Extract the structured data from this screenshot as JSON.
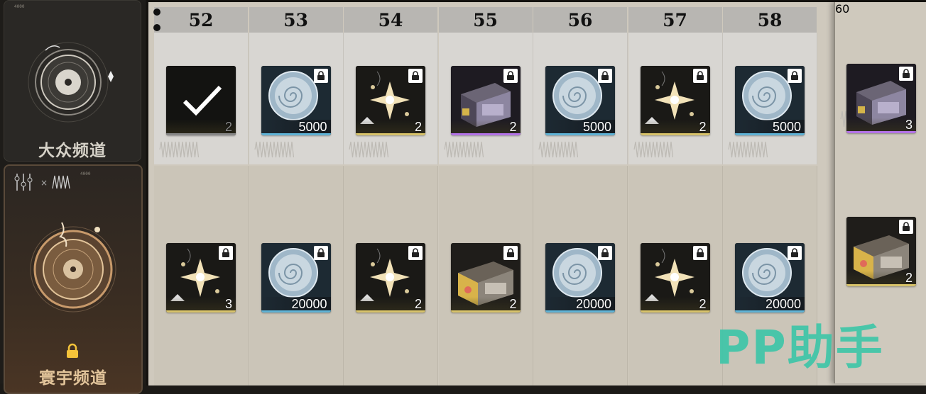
{
  "sidebar": {
    "public_channel": {
      "title": "大众频道",
      "code_label": "4000"
    },
    "premium_channel": {
      "title": "寰宇频道",
      "code_label": "4000",
      "locked": true
    }
  },
  "columns": [
    {
      "level": "52",
      "top": {
        "type": "claimed",
        "qty": "2",
        "icon": "check-icon",
        "locked": false
      },
      "bottom": {
        "type": "spark",
        "qty": "3",
        "locked": true
      }
    },
    {
      "level": "53",
      "top": {
        "type": "coin",
        "qty": "5000",
        "locked": true
      },
      "bottom": {
        "type": "coin",
        "qty": "20000",
        "locked": true
      }
    },
    {
      "level": "54",
      "top": {
        "type": "spark",
        "qty": "2",
        "locked": true
      },
      "bottom": {
        "type": "spark",
        "qty": "2",
        "locked": true
      }
    },
    {
      "level": "55",
      "top": {
        "type": "purple-box",
        "qty": "2",
        "locked": true
      },
      "bottom": {
        "type": "gold-box",
        "qty": "2",
        "locked": true
      }
    },
    {
      "level": "56",
      "top": {
        "type": "coin",
        "qty": "5000",
        "locked": true
      },
      "bottom": {
        "type": "coin",
        "qty": "20000",
        "locked": true
      }
    },
    {
      "level": "57",
      "top": {
        "type": "spark",
        "qty": "2",
        "locked": true
      },
      "bottom": {
        "type": "spark",
        "qty": "2",
        "locked": true
      }
    },
    {
      "level": "58",
      "top": {
        "type": "coin",
        "qty": "5000",
        "locked": true
      },
      "bottom": {
        "type": "coin",
        "qty": "20000",
        "locked": true
      }
    }
  ],
  "pinned_column": {
    "level": "60",
    "top": {
      "type": "purple-box",
      "qty": "3",
      "locked": true
    },
    "bottom": {
      "type": "gold-box",
      "qty": "2",
      "locked": true
    }
  },
  "watermark": "PP助手",
  "colors": {
    "coin": "#5fb3d6",
    "gold": "#d8c36a",
    "purple": "#b573e8",
    "accent_text": "#e2c49a"
  }
}
